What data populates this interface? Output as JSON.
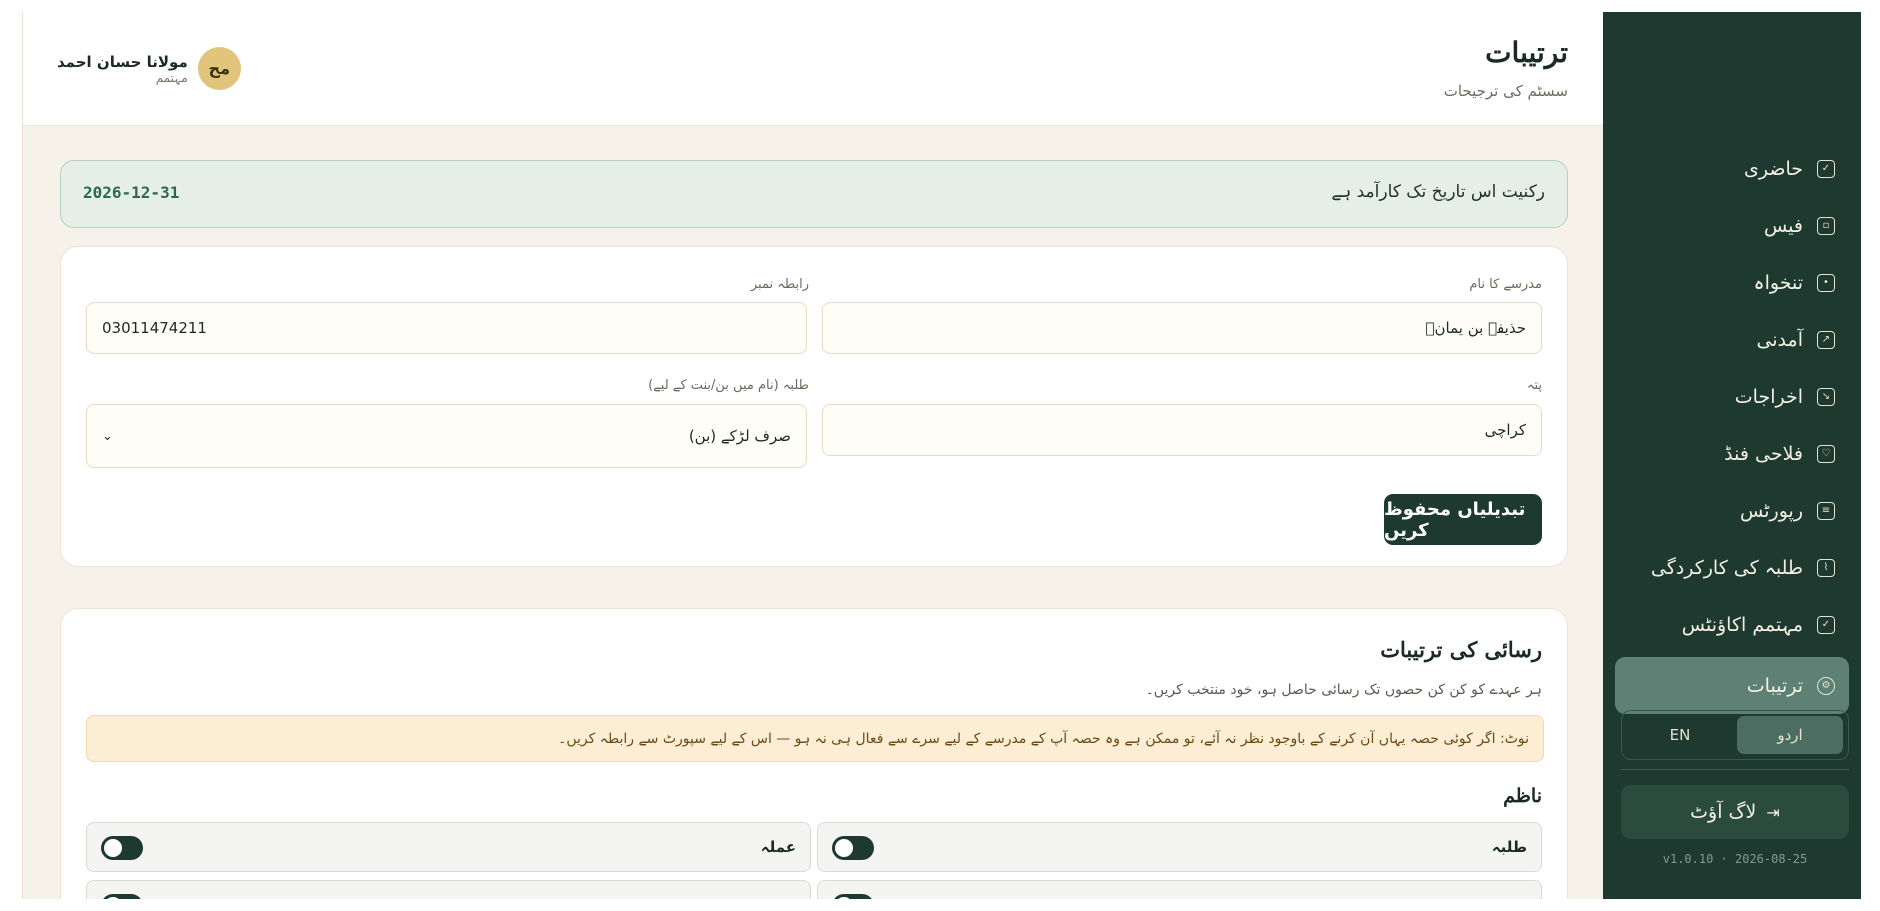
{
  "header": {
    "title": "ترتیبات",
    "subtitle": "سسٹم کی ترجیحات",
    "user": {
      "initials": "مح",
      "name": "مولانا حسان احمد",
      "role": "مہتمم"
    }
  },
  "sidebar": {
    "items": [
      {
        "label": "حاضری",
        "icon": "calendar-check-icon",
        "glyph": "✓"
      },
      {
        "label": "فیس",
        "icon": "wallet-icon",
        "glyph": "▫"
      },
      {
        "label": "تنخواہ",
        "icon": "banknote-icon",
        "glyph": "•"
      },
      {
        "label": "آمدنی",
        "icon": "trending-up-icon",
        "glyph": "↗"
      },
      {
        "label": "اخراجات",
        "icon": "trending-down-icon",
        "glyph": "↘"
      },
      {
        "label": "فلاحی فنڈ",
        "icon": "heart-handshake-icon",
        "glyph": "♡"
      },
      {
        "label": "رپورٹس",
        "icon": "file-chart-icon",
        "glyph": "≡"
      },
      {
        "label": "طلبہ کی کارکردگی",
        "icon": "line-chart-icon",
        "glyph": "⌇"
      },
      {
        "label": "مہتمم اکاؤنٹس",
        "icon": "shield-check-icon",
        "glyph": "✓"
      },
      {
        "label": "ترتیبات",
        "icon": "gear-icon",
        "glyph": "⚙",
        "active": true
      }
    ],
    "language": {
      "options": [
        "EN",
        "اردو"
      ],
      "selected": "اردو"
    },
    "logout_label": "لاگ آؤٹ",
    "version": "v1.0.10 · 2026-08-25"
  },
  "subscription": {
    "text": "رکنیت اس تاریخ تک کارآمد ہے",
    "date": "2026-12-31"
  },
  "school_form": {
    "name_label": "مدرسے کا نام",
    "name_value": "حذیفہ بن یمانؓ",
    "phone_label": "رابطہ نمبر",
    "phone_value": "03011474211",
    "address_label": "پتہ",
    "address_value": "کراچی",
    "students_label": "طلبہ (نام میں بن/بنت کے لیے)",
    "students_value": "صرف لڑکے (بن)",
    "save_label": "تبدیلیاں محفوظ کریں"
  },
  "access": {
    "title": "رسائی کی ترتیبات",
    "subtitle": "ہر عہدے کو کن کن حصوں تک رسائی حاصل ہو، خود منتخب کریں۔",
    "note": "نوٹ: اگر کوئی حصہ یہاں آن کرنے کے باوجود نظر نہ آئے، تو ممکن ہے وہ حصہ آپ کے مدرسے کے لیے سرے سے فعال ہی نہ ہو — اس کے لیے سپورٹ سے رابطہ کریں۔",
    "group": "ناظم",
    "permissions": [
      {
        "label": "طلبہ",
        "enabled": false
      },
      {
        "label": "عملہ",
        "enabled": false
      }
    ]
  },
  "colors": {
    "sidebar_bg": "#1e3a30",
    "accent": "#1e3a30",
    "active_nav": "#5f8074",
    "banner_bg": "#e5efe8",
    "note_bg": "#fbeed5",
    "avatar_bg": "#e0c57a"
  }
}
